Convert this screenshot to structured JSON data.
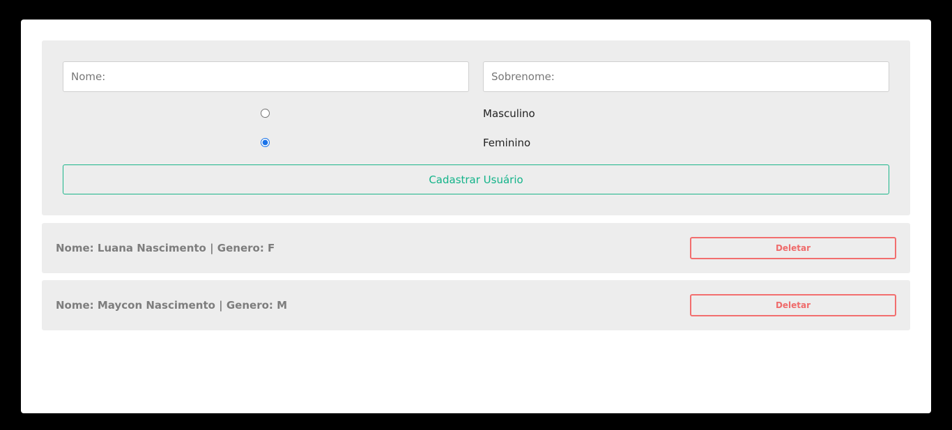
{
  "form": {
    "first_name_placeholder": "Nome:",
    "last_name_placeholder": "Sobrenome:",
    "gender_options": [
      {
        "label": "Masculino",
        "value": "M",
        "checked": false
      },
      {
        "label": "Feminino",
        "value": "F",
        "checked": true
      }
    ],
    "submit_label": "Cadastrar Usuário"
  },
  "users": [
    {
      "text": "Nome: Luana Nascimento | Genero: F",
      "delete_label": "Deletar"
    },
    {
      "text": "Nome: Maycon Nascimento | Genero: M",
      "delete_label": "Deletar"
    }
  ],
  "colors": {
    "submit_accent": "#13b389",
    "delete_accent": "#ef6b6b",
    "panel_bg": "#ededed",
    "radio_accent": "#1a73e8"
  }
}
